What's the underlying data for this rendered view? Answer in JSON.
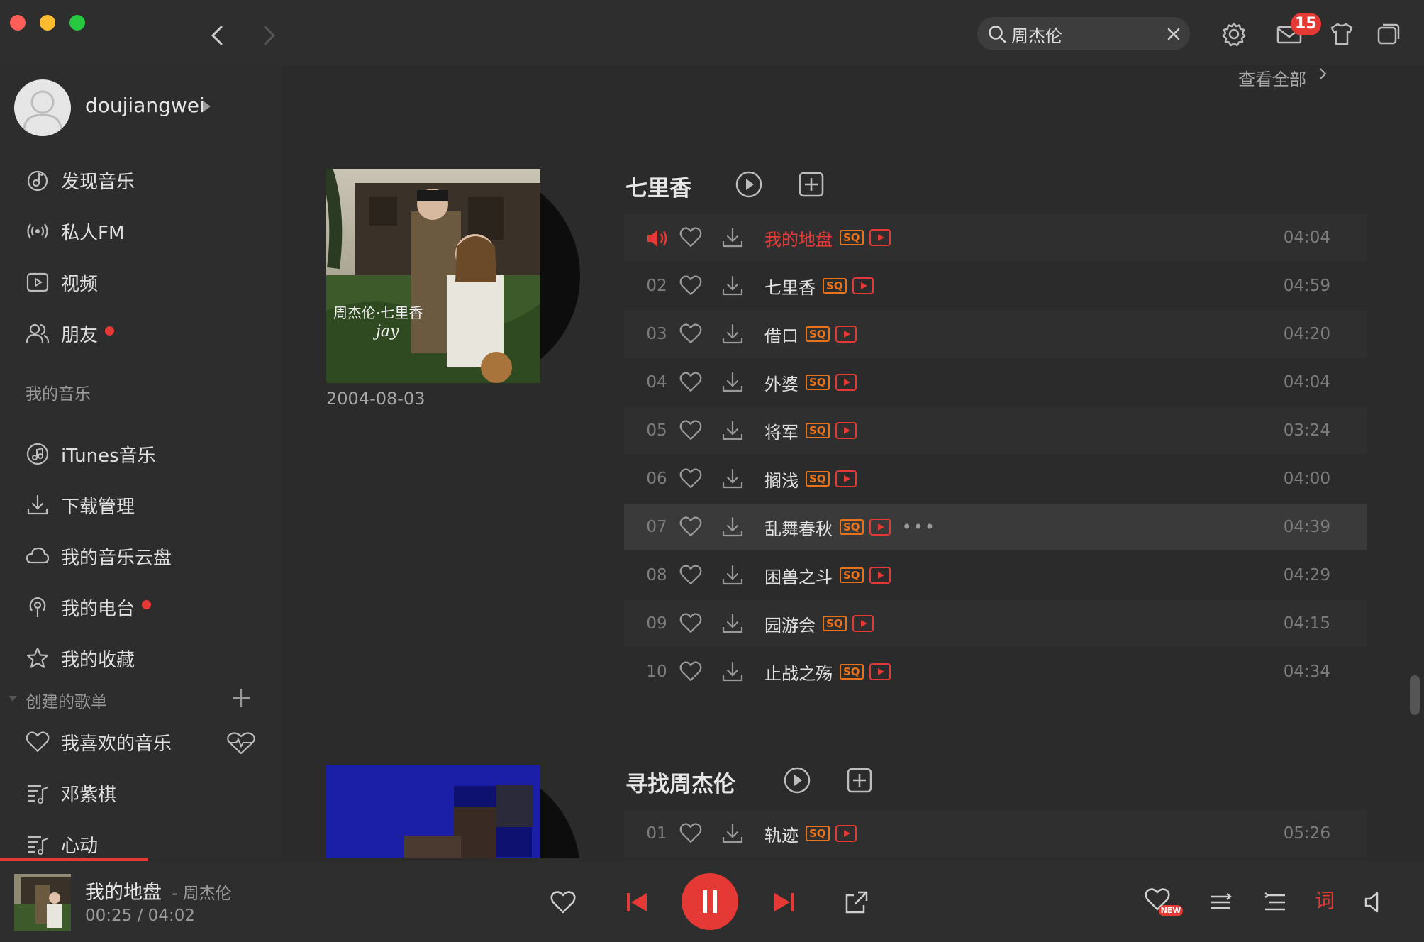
{
  "window": {
    "colors": {
      "accent": "#e53935",
      "close": "#ff5f57",
      "minimize": "#febc2e",
      "maximize": "#28c840",
      "quality": "#e8731b"
    }
  },
  "search": {
    "value": "周杰伦"
  },
  "toolbar": {
    "mail_badge": "15"
  },
  "user": {
    "name": "doujiangwei"
  },
  "sidebar": {
    "main_items": [
      {
        "label": "发现音乐",
        "icon": "music-note-circle-icon"
      },
      {
        "label": "私人FM",
        "icon": "radio-waves-icon"
      },
      {
        "label": "视频",
        "icon": "video-play-icon"
      },
      {
        "label": "朋友",
        "icon": "friends-icon",
        "dot": true
      }
    ],
    "my_music_title": "我的音乐",
    "my_music_items": [
      {
        "label": "iTunes音乐",
        "icon": "itunes-icon"
      },
      {
        "label": "下载管理",
        "icon": "download-icon"
      },
      {
        "label": "我的音乐云盘",
        "icon": "cloud-icon"
      },
      {
        "label": "我的电台",
        "icon": "podcast-icon",
        "dot": true
      },
      {
        "label": "我的收藏",
        "icon": "star-icon"
      }
    ],
    "playlists_title": "创建的歌单",
    "playlist_items": [
      {
        "label": "我喜欢的音乐",
        "icon": "heart-icon"
      },
      {
        "label": "邓紫棋",
        "icon": "playlist-icon"
      },
      {
        "label": "心动",
        "icon": "playlist-icon"
      }
    ]
  },
  "main": {
    "view_all": "查看全部",
    "albums": [
      {
        "title": "七里香",
        "release_date": "2004-08-03",
        "tracks": [
          {
            "num": "",
            "name": "我的地盘",
            "duration": "04:04",
            "playing": true
          },
          {
            "num": "02",
            "name": "七里香",
            "duration": "04:59"
          },
          {
            "num": "03",
            "name": "借口",
            "duration": "04:20"
          },
          {
            "num": "04",
            "name": "外婆",
            "duration": "04:04"
          },
          {
            "num": "05",
            "name": "将军",
            "duration": "03:24"
          },
          {
            "num": "06",
            "name": "搁浅",
            "duration": "04:00"
          },
          {
            "num": "07",
            "name": "乱舞春秋",
            "duration": "04:39",
            "hover": true
          },
          {
            "num": "08",
            "name": "困兽之斗",
            "duration": "04:29"
          },
          {
            "num": "09",
            "name": "园游会",
            "duration": "04:15"
          },
          {
            "num": "10",
            "name": "止战之殇",
            "duration": "04:34"
          }
        ]
      },
      {
        "title": "寻找周杰伦",
        "tracks": [
          {
            "num": "01",
            "name": "轨迹",
            "duration": "05:26"
          }
        ]
      }
    ],
    "quality_label": "SQ",
    "more_label": "•••"
  },
  "player": {
    "title": "我的地盘",
    "artist": "- 周杰伦",
    "elapsed": "00:25",
    "separator": "/",
    "total": "04:02",
    "progress": 0.104,
    "lyrics_label": "词",
    "new_badge": "NEW"
  }
}
